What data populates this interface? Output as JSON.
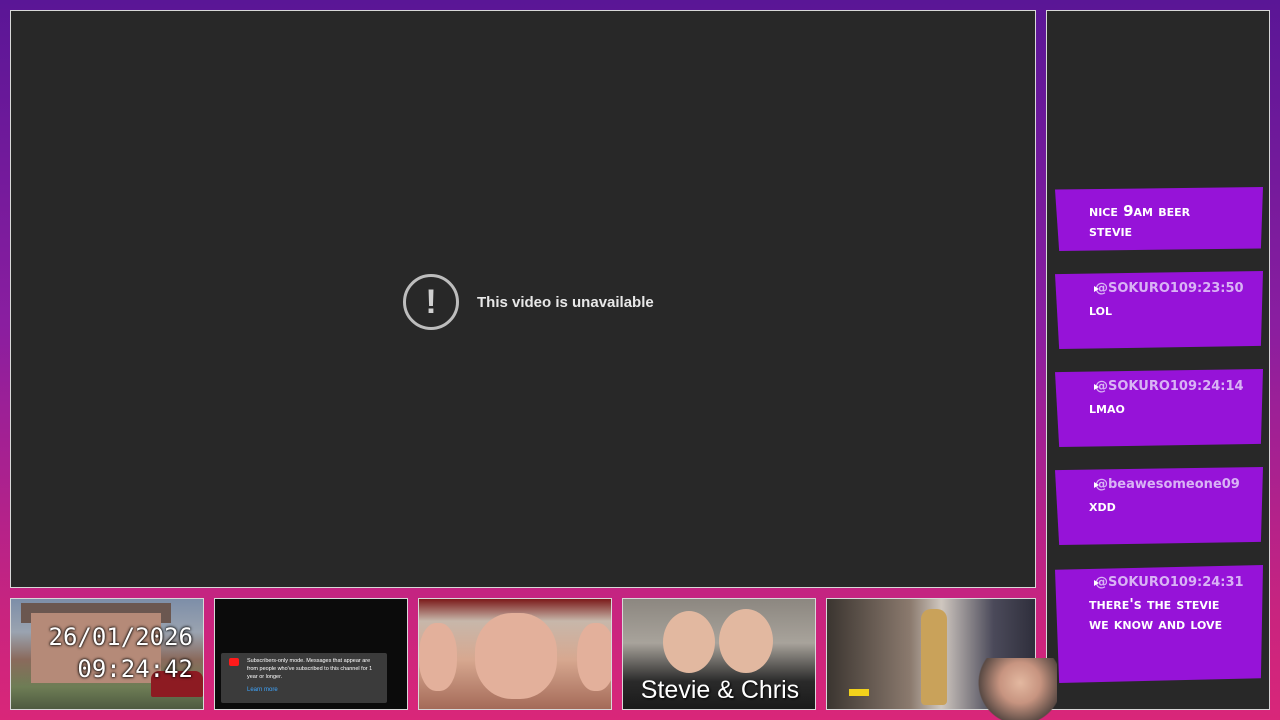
{
  "player": {
    "error_icon": "!",
    "error_message": "This video is unavailable"
  },
  "chat": {
    "messages": [
      {
        "author": "",
        "text": "nice 9am beer stevie"
      },
      {
        "author": "@SOKURO109:23:50",
        "text": "LOL"
      },
      {
        "author": "@SOKURO109:24:14",
        "text": "LMAO"
      },
      {
        "author": "@beawesomeone09",
        "text": "XDD"
      },
      {
        "author": "@SOKURO109:24:31",
        "text": "There's the stevie we know and love"
      }
    ]
  },
  "thumbnails": {
    "clock": {
      "date": "26/01/2026",
      "time": "09:24:42"
    },
    "subscribers_notice": {
      "text": "Subscribers-only mode. Messages that appear are from people who've subscribed to this channel for 1 year or longer.",
      "link": "Learn more"
    },
    "caption": "Stevie & Chris"
  },
  "colors": {
    "chat_bubble": "#9613d8",
    "player_bg": "#282828",
    "youtube_red": "#ff1a1a"
  }
}
